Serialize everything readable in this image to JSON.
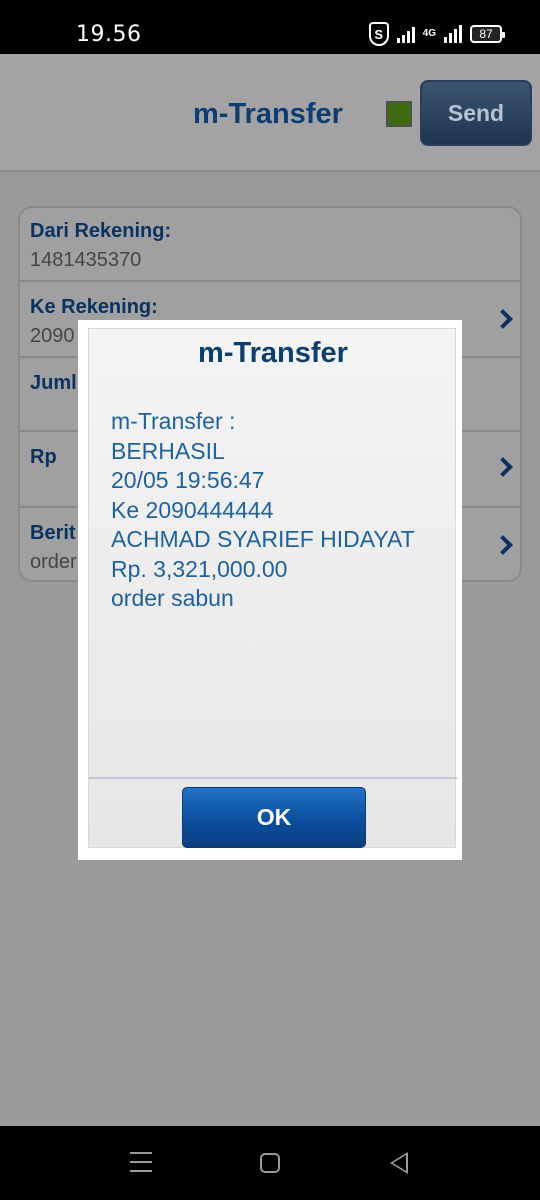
{
  "status_bar": {
    "time": "19.56",
    "security_icon": "shield-s-icon",
    "network_label": "4G",
    "battery": "87"
  },
  "header": {
    "title": "m-Transfer",
    "status_color": "#3f6b12",
    "send_label": "Send"
  },
  "form": {
    "rows": [
      {
        "label": "Dari Rekening:",
        "value": "1481435370"
      },
      {
        "label": "Ke Rekening:",
        "value": "2090"
      },
      {
        "label": "Juml",
        "value": ""
      },
      {
        "label": "Rp",
        "value": ""
      },
      {
        "label": "Berit",
        "value": "order"
      }
    ]
  },
  "dialog": {
    "title": "m-Transfer",
    "lines": [
      "m-Transfer :",
      "BERHASIL",
      "20/05 19:56:47",
      "Ke 2090444444",
      "ACHMAD SYARIEF HIDAYAT",
      "Rp. 3,321,000.00",
      "order sabun"
    ],
    "ok_label": "OK"
  },
  "nav_bar": {
    "icons": [
      "menu-icon",
      "home-icon",
      "back-icon"
    ]
  },
  "colors": {
    "accent": "#0b3e72",
    "dialog_text": "#1d63a3",
    "ok_button": "#0b4e9e"
  }
}
